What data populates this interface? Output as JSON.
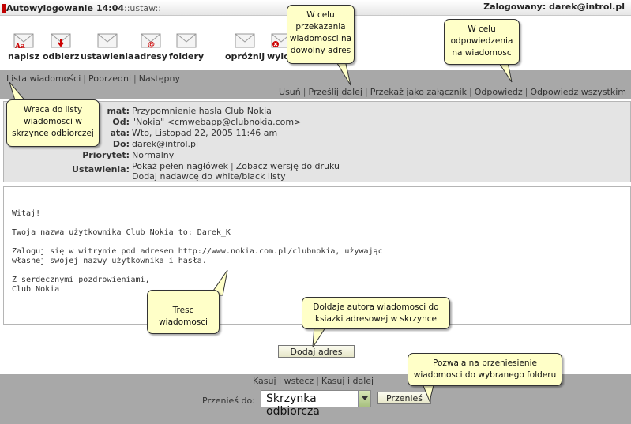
{
  "topbar": {
    "autologout": "Autowylogowanie",
    "time": "14:04",
    "settings_link": "::ustaw::",
    "user_label": "Zalogowany: darek@introl.pl"
  },
  "toolbar": {
    "items": [
      "napisz",
      "odbierz",
      "ustawienia",
      "adresy",
      "foldery",
      "opróżnij",
      "wylog"
    ]
  },
  "nav": {
    "left": [
      "Lista wiadomości",
      "Poprzedni",
      "Następny"
    ],
    "right": [
      "Usuń",
      "Prześlij dalej",
      "Przekaż jako załącznik",
      "Odpowiedz",
      "Odpowiedz wszystkim"
    ]
  },
  "header": {
    "subject_label": "mat:",
    "subject": "Przypomnienie hasła Club Nokia",
    "from_label": "Od:",
    "from": "\"Nokia\" <cmwebapp@clubnokia.com>",
    "date_label": "ata:",
    "date": "Wto, Listopad 22, 2005 11:46 am",
    "to_label": "Do:",
    "to": "darek@introl.pl",
    "priority_label": "Priorytet:",
    "priority": "Normalny",
    "settings_label": "Ustawienia:",
    "settings_line1_a": "Pokaż pełen nagłówek",
    "settings_line1_b": "Zobacz wersję do druku",
    "settings_line2": "Dodaj nadawcę do white/black listy"
  },
  "body": {
    "lines": [
      "Witaj!",
      "Twoja nazwa użytkownika Club Nokia to: Darek_K",
      "Zaloguj się w witrynie pod adresem http://www.nokia.com.pl/clubnokia, używając",
      "własnej swojej nazwy użytkownika i hasła.",
      "Z serdecznymi pozdrowieniami,",
      "Club Nokia"
    ]
  },
  "add_button": "Dodaj adres",
  "bottom": {
    "undo_back": "Kasuj i wstecz",
    "undo_next": "Kasuj i dalej",
    "move_label": "Przenieś do:",
    "folder_selected": "Skrzynka odbiorcza",
    "move_button": "Przenieś"
  },
  "callouts": {
    "forward": [
      "W celu",
      "przekazania",
      "wiadomosci na",
      "dowolny adres"
    ],
    "reply": [
      "W celu",
      "odpowiedzenia",
      "na wiadomosc"
    ],
    "back": [
      "Wraca do listy",
      "wiadomosci w",
      "skrzynce odbiorczej"
    ],
    "content": [
      "Tresc wiadomosci"
    ],
    "add_author": [
      "Doldaje autora wiadomosci do",
      "ksiazki adresowej w skrzynce"
    ],
    "move": [
      "Pozwala na przeniesienie",
      "wiadomosci do wybranego folderu"
    ]
  },
  "colors": {
    "accent_red": "#c00000",
    "bar_gray": "#a8a8a8",
    "panel_gray": "#e4e4e4",
    "callout_yellow": "#ffffc8"
  }
}
